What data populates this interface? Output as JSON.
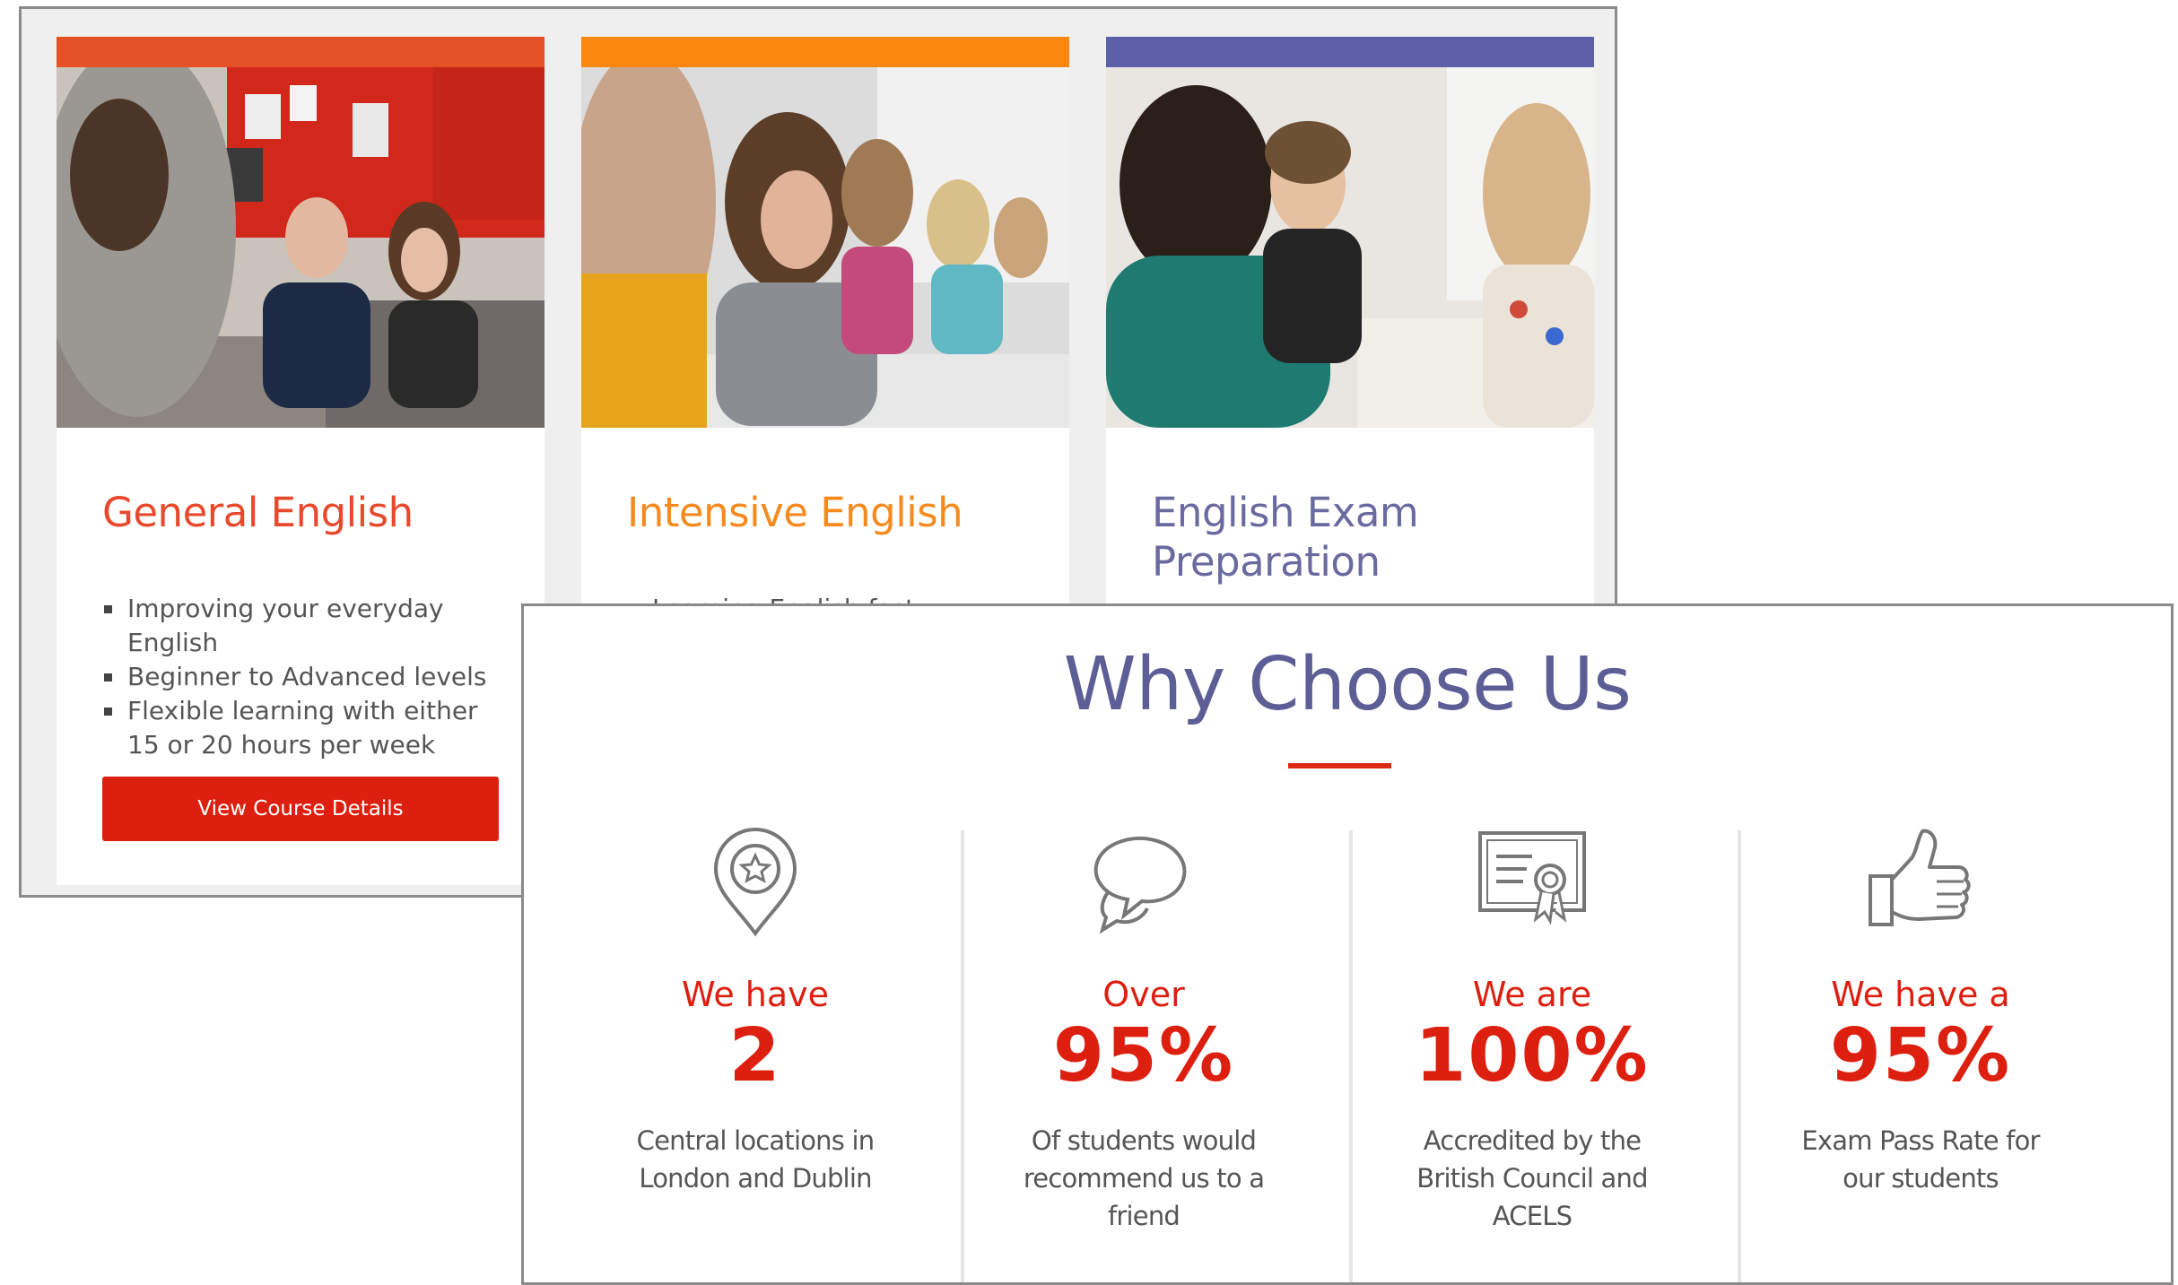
{
  "courses": [
    {
      "title": "General English",
      "color": "#e8492c",
      "bar_color": "#e45125",
      "bullets": [
        "Improving your everyday English",
        "Beginner to Advanced levels",
        "Flexible learning with either 15 or 20 hours per week"
      ],
      "button_label": "View Course Details"
    },
    {
      "title": "Intensive English",
      "color": "#f58a1f",
      "bar_color": "#fb8710",
      "bullets": [
        "Learning English fast"
      ]
    },
    {
      "title": "English Exam Preparation",
      "color": "#6a6aa0",
      "bar_color": "#5d5fa8",
      "bullets": []
    }
  ],
  "why": {
    "title": "Why Choose Us",
    "accent": "#dd1f0f",
    "stats": [
      {
        "icon": "map-pin-star-icon",
        "pre": "We have",
        "value": "2",
        "desc": "Central locations in London and Dublin"
      },
      {
        "icon": "speech-bubbles-icon",
        "pre": "Over",
        "value": "95%",
        "desc": "Of students would recommend us to a friend"
      },
      {
        "icon": "certificate-icon",
        "pre": "We are",
        "value": "100%",
        "desc": "Accredited by the British Council and ACELS"
      },
      {
        "icon": "thumbs-up-icon",
        "pre": "We have a",
        "value": "95%",
        "desc": "Exam Pass Rate for our students"
      }
    ]
  }
}
